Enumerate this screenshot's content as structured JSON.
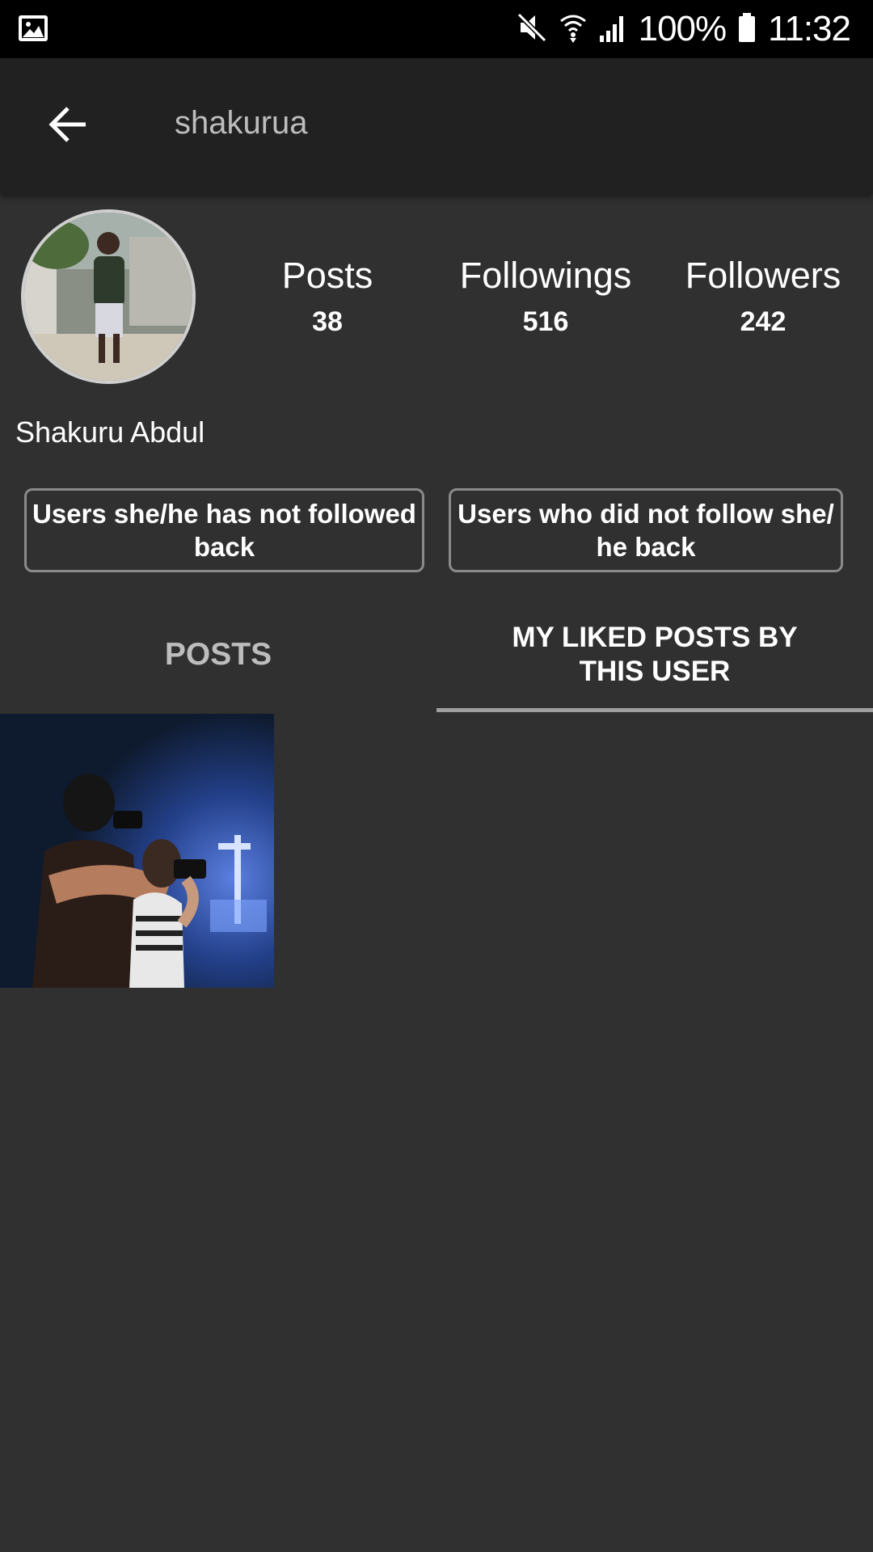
{
  "status_bar": {
    "icons": [
      "image-notification-icon",
      "mute-icon",
      "wifi-icon",
      "signal-icon",
      "battery-icon"
    ],
    "battery": "100%",
    "time": "11:32"
  },
  "app_bar": {
    "back_icon": "arrow-back-icon",
    "title": "shakurua"
  },
  "profile": {
    "avatar_icon": "user-avatar",
    "display_name": "Shakuru Abdul",
    "stats": {
      "posts_label": "Posts",
      "posts_value": "38",
      "followings_label": "Followings",
      "followings_value": "516",
      "followers_label": "Followers",
      "followers_value": "242"
    }
  },
  "actions": {
    "not_followed_back": "Users she/he has not followed back",
    "not_follow_back": "Users who did not follow she/ he back"
  },
  "tabs": {
    "posts": "POSTS",
    "liked": "MY LIKED POSTS BY THIS USER",
    "selected": "liked"
  },
  "colors": {
    "background": "#303030",
    "app_bar": "#212121",
    "status_bar": "#000000",
    "tab_indicator": "#9e9e9e"
  },
  "posts": [
    {
      "image": "concert-photographers-photo"
    }
  ]
}
